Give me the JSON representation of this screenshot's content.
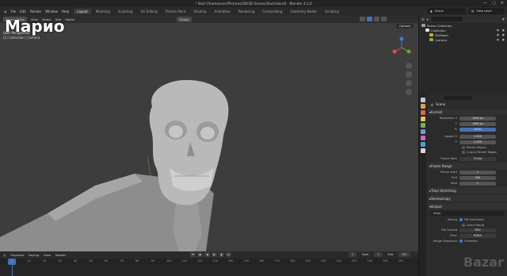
{
  "window": {
    "title": "* Skull [/home/user/Pictures/3D/3D Scenes/Skull.blend] - Blender 4.5.0",
    "minimize_label": "—",
    "maximize_label": "▢",
    "close_label": "✕"
  },
  "overlay_label": "Марио",
  "menu": [
    "File",
    "Edit",
    "Render",
    "Window",
    "Help"
  ],
  "workspace_tabs": [
    "Layout",
    "Modeling",
    "Sculpting",
    "UV Editing",
    "Texture Paint",
    "Shading",
    "Animation",
    "Rendering",
    "Compositing",
    "Geometry Nodes",
    "Scripting"
  ],
  "active_tab": "Layout",
  "scene_selector": "Scene",
  "view_layer_selector": "View Layer",
  "viewport": {
    "header_items": [
      "Object Mode",
      "View",
      "Select",
      "Add",
      "Object"
    ],
    "transform_orientation": "Global",
    "view_name": "User Perspective",
    "collection_info": "(1) Collection | Camera",
    "options_label": "Options"
  },
  "timeline": {
    "header_items": [
      "Playback",
      "Keying",
      "View",
      "Marker"
    ],
    "current_frame": "1",
    "start_label": "Start",
    "start_value": "1",
    "end_label": "End",
    "end_value": "250",
    "ruler_ticks": [
      "0",
      "10",
      "20",
      "30",
      "40",
      "50",
      "60",
      "70",
      "80",
      "90",
      "100",
      "110",
      "120",
      "130",
      "140",
      "150",
      "160",
      "170",
      "180",
      "190",
      "200",
      "210",
      "220",
      "230",
      "240",
      "250"
    ],
    "current_marker": "1"
  },
  "outliner": {
    "rows": [
      {
        "label": "Scene Collection",
        "color": "#9a9a9a",
        "selected": false
      },
      {
        "label": "Collection",
        "color": "#e0e0e0",
        "selected": false
      },
      {
        "label": "SGModel",
        "color": "#e09b49",
        "selected": false
      },
      {
        "label": "Camera",
        "color": "#7fb055",
        "selected": false
      }
    ]
  },
  "properties": {
    "title": "Scene",
    "format_section": "Format",
    "resolution_x_label": "Resolution X",
    "resolution_x": "1920 px",
    "resolution_y_label": "Y",
    "resolution_y": "1080 px",
    "percent_label": "%",
    "percent": "100%",
    "aspect_x_label": "Aspect X",
    "aspect_x": "1.000",
    "aspect_y_label": "Y",
    "aspect_y": "1.000",
    "render_region_label": "Render Region",
    "crop_label": "Crop to Render Region",
    "frame_rate_label": "Frame Rate",
    "frame_rate": "24 fps",
    "frame_range_section": "Frame Range",
    "frame_start_label": "Frame Start",
    "frame_start": "1",
    "end_label": "End",
    "end": "250",
    "step_label": "Step",
    "step": "1",
    "time_stretching": "Time Stretching",
    "stereoscopy": "Stereoscopy",
    "output_section": "Output",
    "output_path": "/tmp/",
    "saving_label": "Saving",
    "file_extensions": "File Extensions",
    "cache_result": "Cache Result",
    "file_format_label": "File Format",
    "file_format": "PNG",
    "color_label": "Color",
    "color_value": "RGBA",
    "image_sequence_label": "Image Sequence",
    "overwrite": "Overwrite"
  },
  "watermark": "Bazar",
  "icons": {
    "outliner_tab_colors": [
      "#c9c9c9",
      "#dba15b",
      "#d06a59",
      "#e0c458",
      "#7fb055",
      "#7d96d3",
      "#c96cc1",
      "#4fa0d9",
      "#d8d8d8"
    ]
  }
}
